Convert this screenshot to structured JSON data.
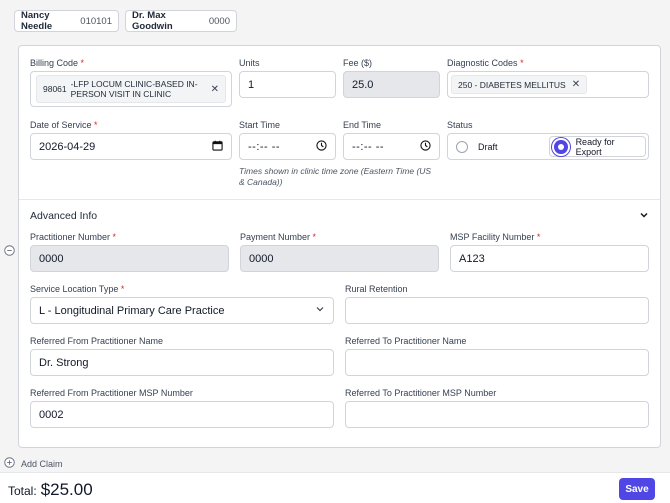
{
  "patient": {
    "name": "Nancy Needle",
    "id": "010101"
  },
  "provider": {
    "name": "Dr. Max Goodwin",
    "id": "0000"
  },
  "claim": {
    "billing_code": {
      "label": "Billing Code",
      "code": "98061",
      "description": "-LFP LOCUM CLINIC-BASED IN-PERSON VISIT IN CLINIC"
    },
    "units": {
      "label": "Units",
      "value": "1"
    },
    "fee": {
      "label": "Fee ($)",
      "value": "25.0"
    },
    "diagnostic_codes": {
      "label": "Diagnostic Codes",
      "values": [
        "250 - DIABETES MELLITUS"
      ]
    },
    "date_of_service": {
      "label": "Date of Service",
      "value": "2026-04-29"
    },
    "start_time": {
      "label": "Start Time",
      "value": "--:-- --"
    },
    "end_time": {
      "label": "End Time",
      "value": "--:-- --"
    },
    "time_hint": "Times shown in clinic time zone (Eastern Time (US & Canada))",
    "status": {
      "label": "Status",
      "options": [
        "Draft",
        "Ready for Export"
      ],
      "selected": "Ready for Export"
    }
  },
  "advanced": {
    "title": "Advanced Info",
    "practitioner_number": {
      "label": "Practitioner Number",
      "value": "0000"
    },
    "payment_number": {
      "label": "Payment Number",
      "value": "0000"
    },
    "msp_facility_number": {
      "label": "MSP Facility Number",
      "value": "A123"
    },
    "service_location_type": {
      "label": "Service Location Type",
      "value": "L - Longitudinal Primary Care Practice"
    },
    "rural_retention": {
      "label": "Rural Retention",
      "value": ""
    },
    "referred_from_name": {
      "label": "Referred From Practitioner Name",
      "value": "Dr. Strong"
    },
    "referred_to_name": {
      "label": "Referred To Practitioner Name",
      "value": ""
    },
    "referred_from_msp": {
      "label": "Referred From Practitioner MSP Number",
      "value": "0002"
    },
    "referred_to_msp": {
      "label": "Referred To Practitioner MSP Number",
      "value": ""
    }
  },
  "add_claim_label": "Add Claim",
  "footer": {
    "total_label": "Total:",
    "total_value": "$25.00",
    "save_label": "Save"
  },
  "colors": {
    "accent": "#4f46e5",
    "required": "#dc2626",
    "readonly_bg": "#e5e7eb"
  }
}
